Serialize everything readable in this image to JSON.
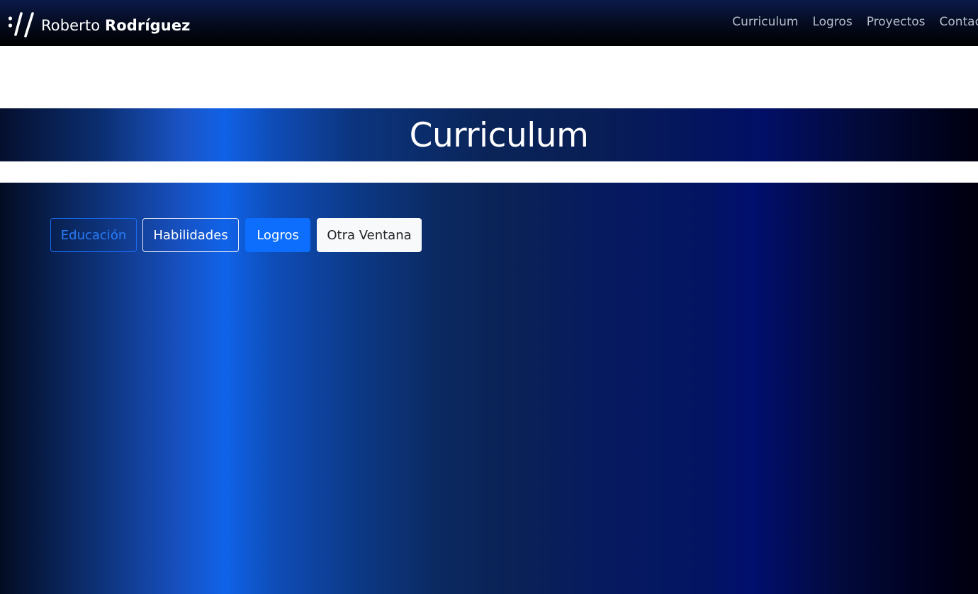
{
  "navbar": {
    "brand": {
      "logo_icon": "double-slash-logo-icon",
      "first_name": "Roberto",
      "last_name": "Rodríguez"
    },
    "links": [
      {
        "label": "Curriculum"
      },
      {
        "label": "Logros"
      },
      {
        "label": "Proyectos"
      },
      {
        "label": "Contacto"
      }
    ]
  },
  "banner": {
    "title": "Curriculum"
  },
  "tabs": {
    "items": [
      {
        "label": "Educación",
        "style": "outline-primary"
      },
      {
        "label": "Habilidades",
        "style": "outline-light"
      },
      {
        "label": "Logros",
        "style": "primary"
      },
      {
        "label": "Otra Ventana",
        "style": "light"
      }
    ]
  },
  "colors": {
    "navbar_bg": "#050d24",
    "accent_blue": "#0d6efd",
    "gradient_highlight": "#1061e6",
    "gradient_dark": "#00000e",
    "light_button": "#f8f9fa",
    "nav_text": "#b6bcc8"
  }
}
